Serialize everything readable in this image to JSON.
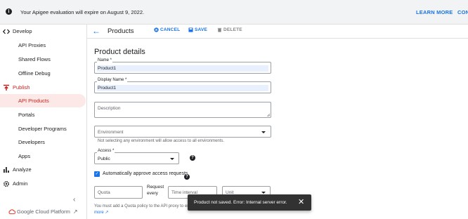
{
  "banner": {
    "message": "Your Apigee evaluation will expire on August 9, 2022.",
    "learn_more": "LEARN MORE",
    "continue": "CONT"
  },
  "sidebar": {
    "develop": "Develop",
    "api_proxies": "API Proxies",
    "shared_flows": "Shared Flows",
    "offline_debug": "Offline Debug",
    "publish": "Publish",
    "api_products": "API Products",
    "portals": "Portals",
    "developer_programs": "Developer Programs",
    "developers": "Developers",
    "apps": "Apps",
    "analyze": "Analyze",
    "admin": "Admin",
    "footer": "Google Cloud Platform"
  },
  "toolbar": {
    "title": "Products",
    "cancel": "CANCEL",
    "save": "SAVE",
    "delete": "DELETE"
  },
  "form": {
    "section_title": "Product details",
    "name_label": "Name *",
    "name_value": "Product1",
    "display_name_label": "Display Name *",
    "display_name_value": "Product1",
    "description_placeholder": "Description",
    "environment_placeholder": "Environment",
    "environment_hint": "Not selecting any environment will allow access to all environments.",
    "access_label": "Access *",
    "access_value": "Public",
    "auto_approve_label": "Automatically approve access requests",
    "quota_placeholder": "Quota",
    "request_every_line1": "Request",
    "request_every_line2": "every",
    "time_interval_placeholder": "Time interval",
    "unit_placeholder": "Unit",
    "quota_note": "You must add a Quota policy to the API proxy to en",
    "quota_more": "more"
  },
  "toast": {
    "message": "Product not saved. Error: Internal server error."
  },
  "colors": {
    "accent": "#1a73e8",
    "active_nav": "#c5221f",
    "toast_bg": "#323232"
  }
}
